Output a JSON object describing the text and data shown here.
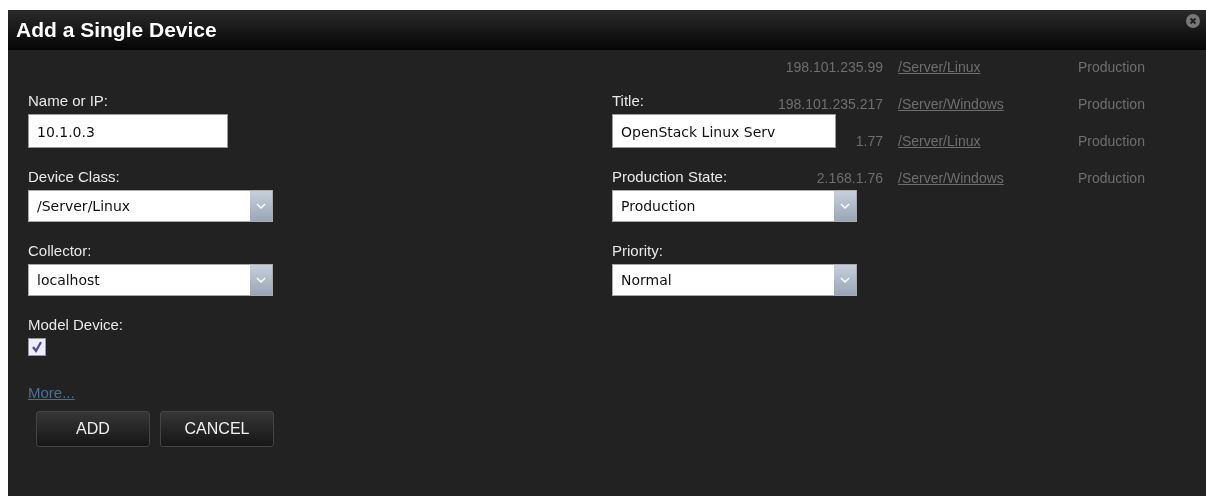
{
  "dialog": {
    "title": "Add a Single Device"
  },
  "background_rows": [
    {
      "ip": "198.101.235.99",
      "device_class": "/Server/Linux",
      "state": "Production"
    },
    {
      "ip": "198.101.235.217",
      "device_class": "/Server/Windows",
      "state": "Production"
    },
    {
      "ip": "1.77",
      "device_class": "/Server/Linux",
      "state": "Production"
    },
    {
      "ip": "2.168.1.76",
      "device_class": "/Server/Windows",
      "state": "Production"
    }
  ],
  "left_fields": [
    {
      "kind": "text",
      "label": "Name or IP:",
      "value": "10.1.0.3"
    },
    {
      "kind": "select",
      "label": "Device Class:",
      "value": "/Server/Linux"
    },
    {
      "kind": "select",
      "label": "Collector:",
      "value": "localhost"
    },
    {
      "kind": "checkbox",
      "label": "Model Device:",
      "checked": true
    }
  ],
  "right_fields": [
    {
      "kind": "text",
      "label": "Title:",
      "value": "OpenStack Linux Serv"
    },
    {
      "kind": "select",
      "label": "Production State:",
      "value": "Production"
    },
    {
      "kind": "select",
      "label": "Priority:",
      "value": "Normal"
    }
  ],
  "more_link": "More...",
  "buttons": [
    "ADD",
    "CANCEL"
  ]
}
